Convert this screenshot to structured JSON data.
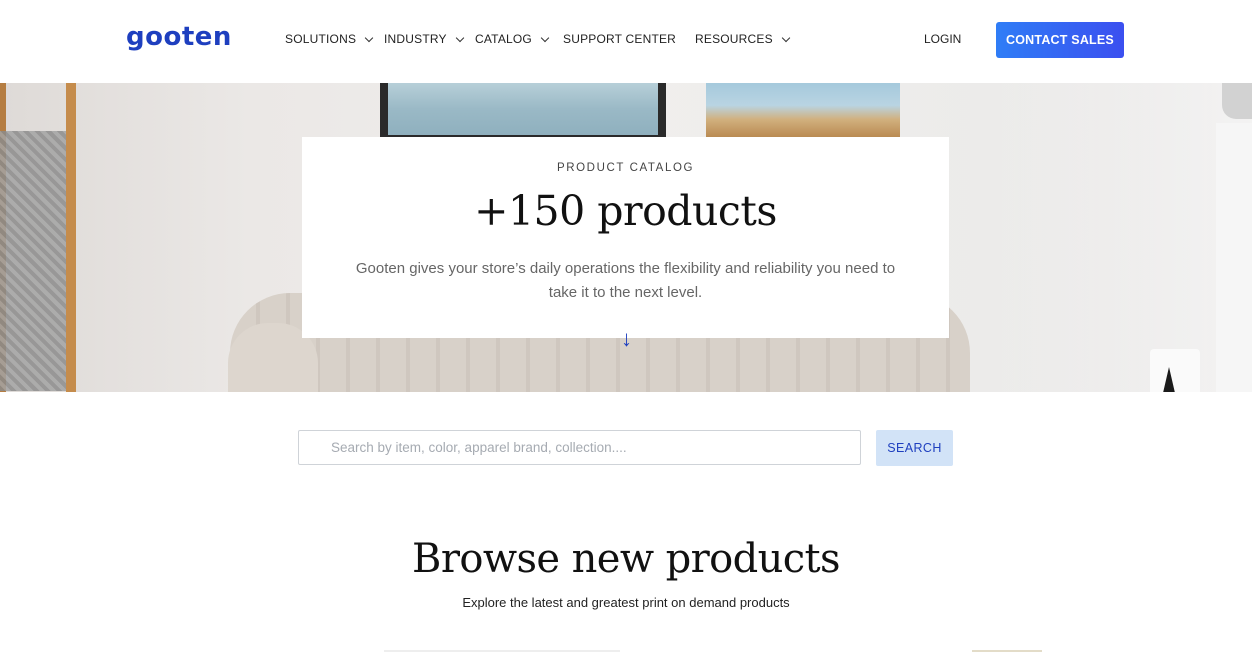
{
  "header": {
    "logo": "gooten",
    "nav": [
      {
        "label": "SOLUTIONS",
        "has_dropdown": true
      },
      {
        "label": "INDUSTRY",
        "has_dropdown": true
      },
      {
        "label": "CATALOG",
        "has_dropdown": true
      },
      {
        "label": "SUPPORT CENTER",
        "has_dropdown": false
      },
      {
        "label": "RESOURCES",
        "has_dropdown": true
      }
    ],
    "login": "LOGIN",
    "contact_sales": "CONTACT SALES"
  },
  "hero": {
    "eyebrow": "PRODUCT CATALOG",
    "title": "+150 products",
    "subtitle": "Gooten gives your store’s daily operations the flexibility and reliability you need to take it to the next level.",
    "scroll_icon": "arrow-down-icon"
  },
  "search": {
    "placeholder": "Search by item, color, apparel brand, collection....",
    "value": "",
    "button": "SEARCH"
  },
  "browse": {
    "title": "Browse new products",
    "subtitle": "Explore the latest and greatest print on demand products"
  },
  "colors": {
    "brand_blue": "#1e3fbf",
    "cta_gradient_start": "#2f7df6",
    "cta_gradient_end": "#3b4ff0",
    "search_button_bg": "#d2e3f7"
  }
}
